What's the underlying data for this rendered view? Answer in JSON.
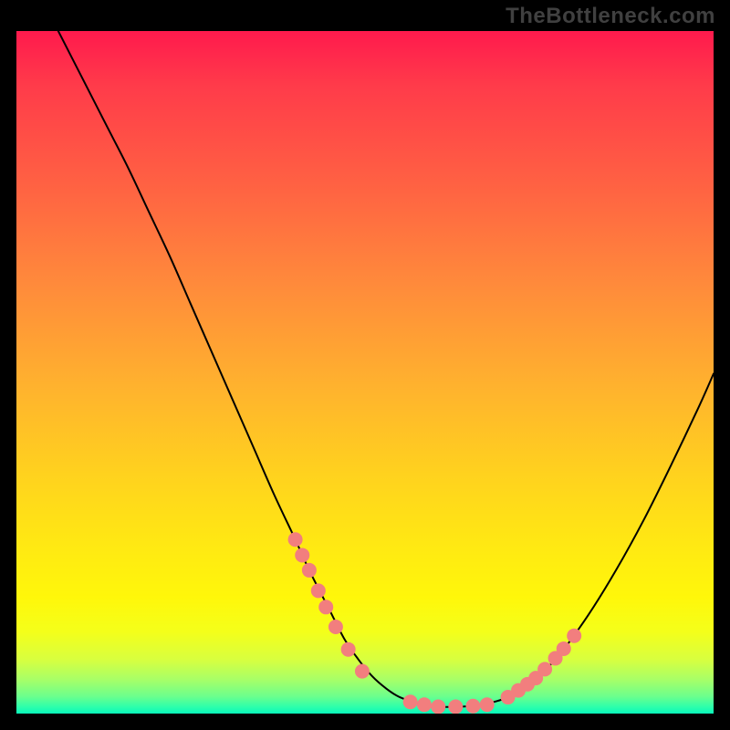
{
  "watermark": "TheBottleneck.com",
  "colors": {
    "page_bg": "#000000",
    "watermark": "#404040",
    "curve": "#000000",
    "marker": "#f27e7e",
    "gradient_top": "#ff1a4d",
    "gradient_bottom": "#09f7ba"
  },
  "chart_data": {
    "type": "line",
    "title": "",
    "xlabel": "",
    "ylabel": "",
    "xlim": [
      0,
      100
    ],
    "ylim": [
      0,
      100
    ],
    "grid": false,
    "legend": false,
    "series": [
      {
        "name": "bottleneck-curve",
        "x": [
          6,
          8,
          10,
          13,
          16,
          19,
          22,
          25,
          28,
          31,
          34,
          37,
          40,
          42,
          45,
          47,
          49,
          51,
          53,
          55,
          58,
          60,
          63,
          66,
          70,
          74,
          78,
          82,
          86,
          90,
          94,
          98,
          100
        ],
        "values": [
          100,
          96,
          92,
          86,
          80,
          73.5,
          67,
          60,
          53,
          46,
          39,
          32,
          25.5,
          21,
          15,
          11,
          8,
          5.5,
          3.7,
          2.4,
          1.4,
          1.0,
          1.0,
          1.2,
          2.2,
          4.6,
          8.8,
          14.4,
          21,
          28.4,
          36.6,
          45.2,
          49.8
        ]
      }
    ],
    "markers": [
      {
        "name": "left-descent-markers",
        "x": [
          40.0,
          41.0,
          42.0,
          43.3,
          44.4,
          45.8,
          47.6,
          49.6
        ],
        "y": [
          25.5,
          23.2,
          21.0,
          18.0,
          15.6,
          12.7,
          9.4,
          6.2
        ]
      },
      {
        "name": "valley-markers",
        "x": [
          56.5,
          58.5,
          60.5,
          63.0,
          65.5,
          67.5
        ],
        "y": [
          1.7,
          1.3,
          1.0,
          1.0,
          1.1,
          1.3
        ]
      },
      {
        "name": "right-ascent-markers",
        "x": [
          70.5,
          72.0,
          73.3,
          74.5,
          75.8,
          77.3,
          78.5,
          80.0
        ],
        "y": [
          2.4,
          3.4,
          4.3,
          5.2,
          6.5,
          8.1,
          9.5,
          11.4
        ]
      }
    ]
  }
}
